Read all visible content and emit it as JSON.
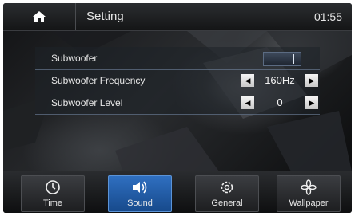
{
  "header": {
    "title": "Setting",
    "time": "01:55",
    "home_icon": "home-icon"
  },
  "settings": {
    "rows": [
      {
        "label": "Subwoofer",
        "control": "toggle",
        "state": "on"
      },
      {
        "label": "Subwoofer Frequency",
        "control": "stepper",
        "value": "160Hz"
      },
      {
        "label": "Subwoofer Level",
        "control": "stepper",
        "value": "0"
      }
    ],
    "left_arrow": "◀",
    "right_arrow": "▶"
  },
  "tabs": [
    {
      "label": "Time",
      "icon": "clock-icon",
      "active": false
    },
    {
      "label": "Sound",
      "icon": "speaker-icon",
      "active": true
    },
    {
      "label": "General",
      "icon": "gear-icon",
      "active": false
    },
    {
      "label": "Wallpaper",
      "icon": "flower-icon",
      "active": false
    }
  ],
  "colors": {
    "active_tab": "#2f6fc0",
    "background": "#070809"
  }
}
